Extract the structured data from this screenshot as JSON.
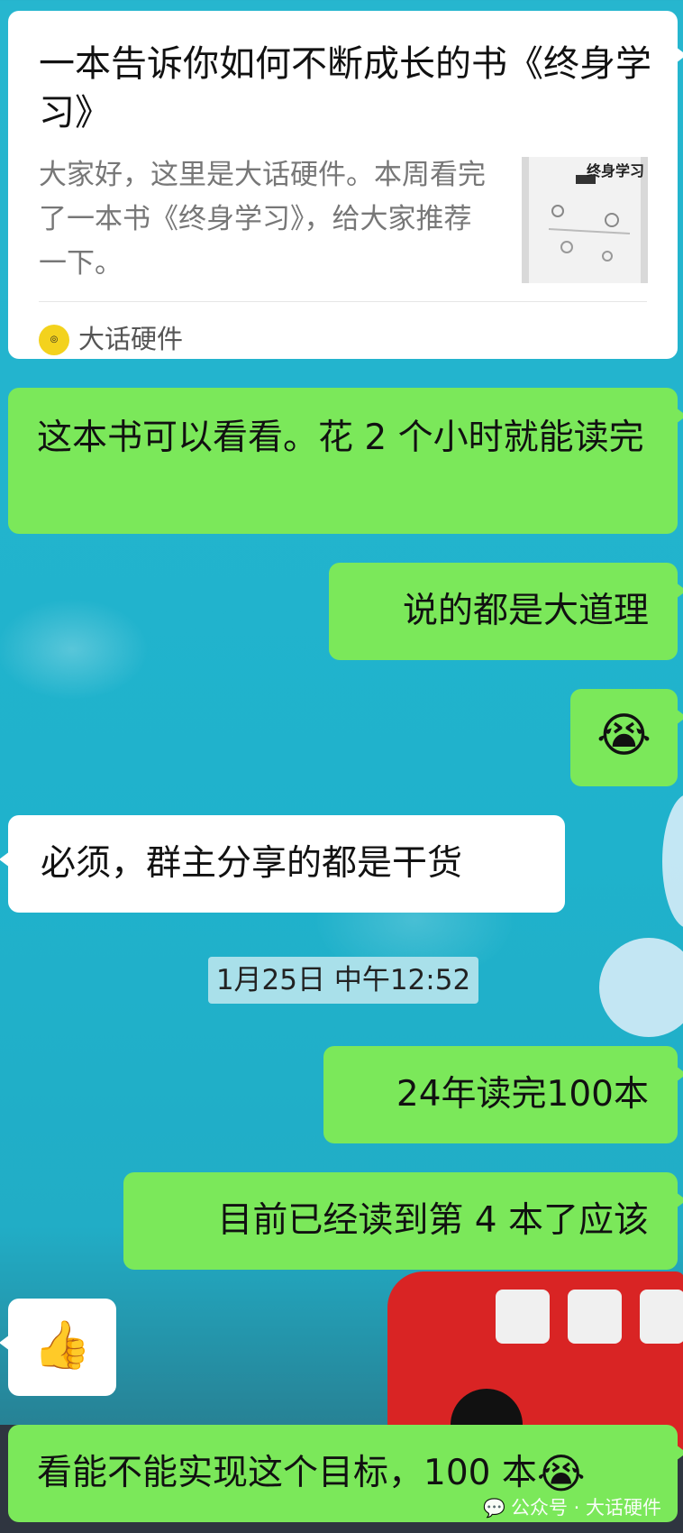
{
  "card": {
    "title": "一本告诉你如何不断成长的书《终身学习》",
    "description": "大家好，这里是大话硬件。本周看完了一本书《终身学习》，给大家推荐一下。",
    "thumbnail_text": "终身学习",
    "source_name": "大话硬件"
  },
  "messages": [
    {
      "side": "right",
      "text": "这本书可以看看。花 2 个小时就能读完"
    },
    {
      "side": "right",
      "text": "说的都是大道理"
    },
    {
      "side": "right",
      "emoji": "😭"
    },
    {
      "side": "left",
      "text": "必须，群主分享的都是干货"
    },
    {
      "side": "right",
      "text": "24年读完100本"
    },
    {
      "side": "right",
      "text": "目前已经读到第 4 本了应该"
    },
    {
      "side": "left",
      "emoji": "👍"
    },
    {
      "side": "right",
      "text": "看能不能实现这个目标，100 本",
      "emoji": "😭"
    }
  ],
  "timestamp": "1月25日 中午12:52",
  "watermark": {
    "icon": "wechat-icon",
    "text": "公众号 · 大话硬件"
  },
  "colors": {
    "outgoing_bubble": "#7be85a",
    "incoming_bubble": "#ffffff",
    "background": "#26b6cf"
  }
}
